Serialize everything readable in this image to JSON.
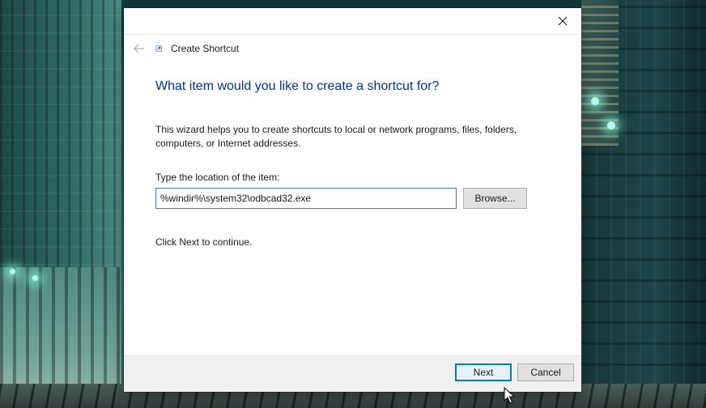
{
  "window": {
    "title": "Create Shortcut",
    "close_label": "✕"
  },
  "wizard": {
    "heading": "What item would you like to create a shortcut for?",
    "description": "This wizard helps you to create shortcuts to local or network programs, files, folders, computers, or Internet addresses.",
    "location_label": "Type the location of the item:",
    "location_value": "%windir%\\system32\\odbcad32.exe",
    "browse_label": "Browse...",
    "continue_text": "Click Next to continue."
  },
  "footer": {
    "next_label": "Next",
    "cancel_label": "Cancel"
  },
  "icons": {
    "close": "close-icon",
    "back": "back-arrow-icon",
    "wizard": "shortcut-wizard-icon",
    "cursor": "mouse-pointer-icon"
  },
  "colors": {
    "heading": "#003399",
    "input_border": "#3c7fc7",
    "next_border": "#0078d7",
    "footer_bg": "#f0f0f0"
  }
}
